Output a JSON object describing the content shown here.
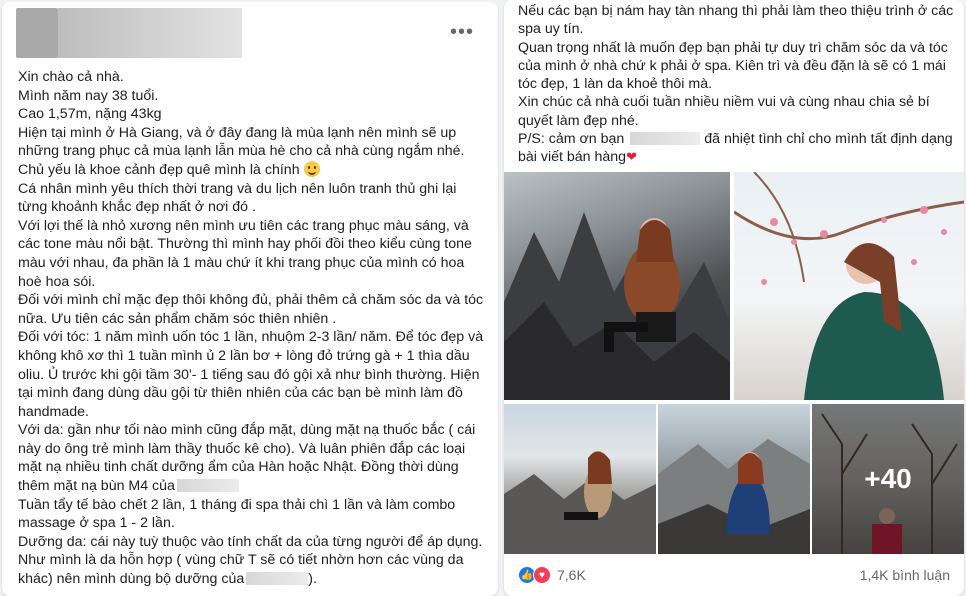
{
  "left_post": {
    "more_icon": "more-horizontal-icon",
    "lines": [
      "Xin chào cả nhà.",
      "Mình năm nay 38 tuổi.",
      "Cao 1,57m, nặng 43kg",
      "Hiện tại mình ở Hà Giang, và ở đây đang là mùa lạnh nên mình sẽ up những trang phục cả mùa lạnh lẫn mùa hè cho cả nhà cùng ngắm nhé.",
      "Chủ yếu là khoe cảnh đẹp quê mình là chính",
      "Cá nhân mình yêu thích thời trang và du lịch nên luôn tranh thủ ghi lại từng khoảnh khắc đẹp nhất ở nơi đó .",
      "Với lợi thế là nhỏ xương nên mình ưu tiên các trang phục màu sáng, và các tone màu nổi bật. Thường thì mình hay phối đồi theo kiểu cùng tone màu với nhau, đa phần là 1 màu chứ ít khi trang phục của mình có hoa hoè hoa sói.",
      "Đối với mình chỉ mặc đẹp thôi không đủ, phải thêm cả chăm sóc da và tóc nữa. Ưu tiên các sản phẩm chăm sóc thiên nhiên .",
      "Đối với tóc: 1 năm mình uốn tóc 1 lần, nhuộm 2-3 lần/ năm. Để tóc đẹp và không khô xơ thì 1 tuần mình ủ 2 lần bơ + lòng đỏ trứng gà + 1 thìa dầu oliu. Ủ trước khi gội tầm 30'- 1 tiếng sau đó gội xả như bình thường. Hiện tại mình đang dùng dầu gội từ thiên nhiên của các bạn bè mình làm đồ handmade.",
      "Với da: gần như tối nào mình cũng đắp mặt, dùng mặt nạ thuốc bắc ( cái này do ông trẻ mình làm thầy thuốc kê cho). Và luân phiên đắp các loại mặt nạ nhiều tinh chất dưỡng ẩm của Hàn hoặc Nhật. Đồng thời dùng thêm mặt nạ bùn M4 của",
      "Tuần tẩy tế bào chết 2 lần, 1 tháng đi spa thải chì 1 lần và làm combo massage ở spa 1 - 2 lần.",
      "Dưỡng da: cái này tuỳ thuộc vào tính chất da của từng người để áp dụng. Như mình là da hỗn hợp ( vùng chữ T sẽ có tiết nhờn hơn các vùng da khác) nên mình dùng bộ dưỡng của",
      ")."
    ],
    "smile_icon": "smile-emoji-icon"
  },
  "right_post": {
    "lines": [
      "Nếu các bạn bị nám hay tàn nhang thì phải làm theo thiệu trình ở các spa uy tín.",
      "Quan trọng nhất là muốn đẹp bạn phải tự duy trì chăm sóc da và tóc của mình ở nhà chứ k phải ở spa. Kiên trì và đều đặn là sẽ có 1 mái tóc đẹp, 1 làn da khoẻ thôi mà.",
      "Xin chúc cả nhà cuối tuần nhiều niềm vui và cùng nhau chia sẻ bí quyết làm đẹp nhé.",
      "P/S: cảm ơn bạn",
      "đã nhiệt tình chỉ cho mình tất định dạng bài viết bán hàng"
    ],
    "heart_glyph": "❤",
    "photos_more": "+40",
    "reaction_count": "7,6K",
    "comment_count": "1,4K bình luận",
    "like_icon": "like-reaction-icon",
    "love_icon": "love-reaction-icon",
    "colors": {
      "like": "#1877f2",
      "love": "#f33e58",
      "text": "#1c1e21",
      "meta": "#65676b"
    }
  }
}
